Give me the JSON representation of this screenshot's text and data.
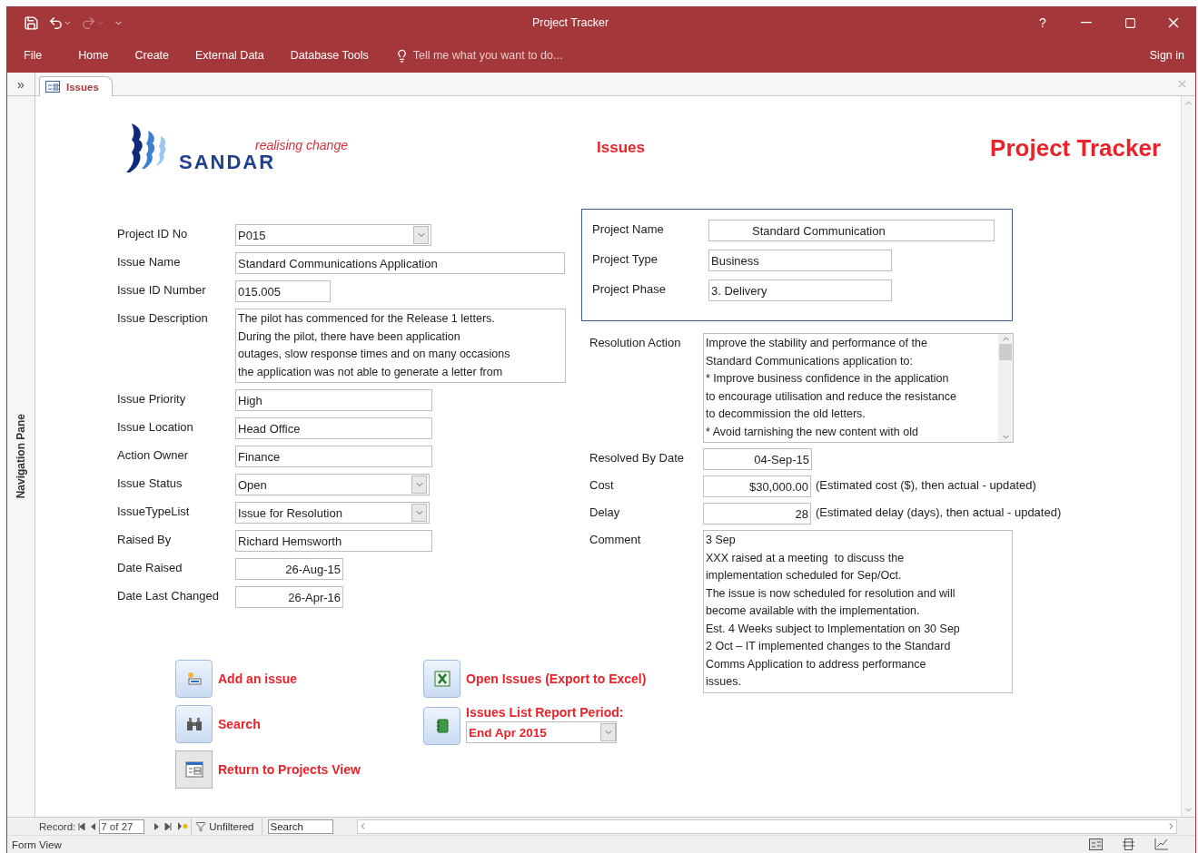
{
  "window": {
    "title": "Project Tracker",
    "help": "?"
  },
  "ribbon_tabs": [
    {
      "label": "File"
    },
    {
      "label": "Home"
    },
    {
      "label": "Create"
    },
    {
      "label": "External Data"
    },
    {
      "label": "Database Tools"
    }
  ],
  "tell_me": {
    "placeholder": "Tell me what you want to do..."
  },
  "sign_in": "Sign in",
  "navigation_pane": {
    "toggle": "»",
    "label": "Navigation Pane"
  },
  "document_tabs": [
    {
      "label": "Issues",
      "selected": true
    }
  ],
  "form": {
    "logo": {
      "name": "SANDAR",
      "tagline": "realising change"
    },
    "heading": "Issues",
    "app_title": "Project Tracker",
    "left_fields": [
      {
        "label": "Project ID No",
        "value": "P015",
        "kind": "combo"
      },
      {
        "label": "Issue Name",
        "value": "Standard Communications Application",
        "kind": "text"
      },
      {
        "label": "Issue ID Number",
        "value": "015.005",
        "kind": "text"
      },
      {
        "label": "Issue Description",
        "value": "The pilot has commenced for the Release 1 letters.\nDuring the pilot, there have been application\noutages, slow response times and on many occasions\nthe application was not able to generate a letter from",
        "kind": "memo"
      },
      {
        "label": "Issue Priority",
        "value": "High",
        "kind": "text"
      },
      {
        "label": "Issue Location",
        "value": "Head Office",
        "kind": "text"
      },
      {
        "label": "Action Owner",
        "value": "Finance",
        "kind": "text"
      },
      {
        "label": "Issue Status",
        "value": "Open",
        "kind": "combo"
      },
      {
        "label": "IssueTypeList",
        "value": "Issue for Resolution",
        "kind": "combo"
      },
      {
        "label": "Raised By",
        "value": "Richard Hemsworth",
        "kind": "text"
      },
      {
        "label": "Date Raised",
        "value": "26-Aug-15",
        "kind": "date"
      },
      {
        "label": "Date Last Changed",
        "value": "26-Apr-16",
        "kind": "date"
      }
    ],
    "project_box": [
      {
        "label": "Project Name",
        "value": "Standard Communication",
        "kind": "text"
      },
      {
        "label": "Project Type",
        "value": "Business",
        "kind": "text"
      },
      {
        "label": "Project Phase",
        "value": "3. Delivery",
        "kind": "text"
      }
    ],
    "right_fields": [
      {
        "label": "Resolution Action",
        "value": "Improve the stability and performance of the\nStandard Communications application to:\n* Improve business confidence in the application\nto encourage utilisation and reduce the resistance\nto decommission the old letters.\n* Avoid tarnishing the new content with old",
        "kind": "scrolling_memo"
      },
      {
        "label": "Resolved By Date",
        "value": "04-Sep-15",
        "kind": "date"
      },
      {
        "label": "Cost",
        "value": "$30,000.00",
        "kind": "date",
        "note": "(Estimated cost ($), then actual - updated)"
      },
      {
        "label": "Delay",
        "value": "28",
        "kind": "date",
        "note": "(Estimated delay (days), then actual - updated)"
      },
      {
        "label": "Comment",
        "value": "3 Sep\nXXX raised at a meeting  to discuss the\nimplementation scheduled for Sep/Oct.\nThe issue is now scheduled for resolution and will\nbecome available with the implementation.\nEst. 4 Weeks subject to Implementation on 30 Sep\n2 Oct – IT implemented changes to the Standard\nComms Application to address performance\nissues.",
        "kind": "memo"
      }
    ],
    "buttons": [
      {
        "label": "Add an issue",
        "kind": "add"
      },
      {
        "label": "Search",
        "kind": "search"
      },
      {
        "label": "Return to Projects View",
        "kind": "return"
      },
      {
        "label": "Open Issues (Export to Excel)",
        "kind": "excel"
      },
      {
        "label": "Issues List Report Period:",
        "kind": "report",
        "value": "End Apr 2015"
      }
    ]
  },
  "record_nav": {
    "label": "Record:",
    "position": "7 of 27",
    "filter": "Unfiltered",
    "search": {
      "placeholder": "Search"
    }
  },
  "status_bar": {
    "text": "Form View"
  }
}
